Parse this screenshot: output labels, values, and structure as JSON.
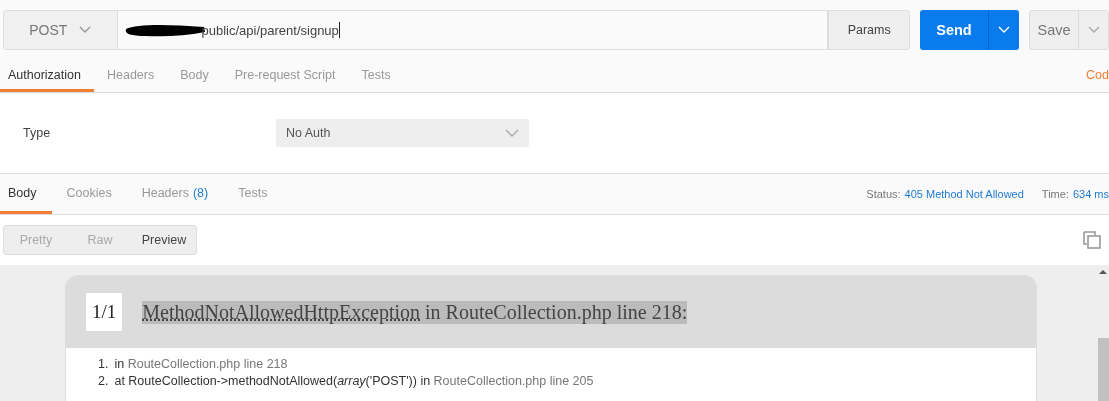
{
  "request": {
    "method": "POST",
    "url": "public/api/parent/signup",
    "url_redacted": true,
    "params_label": "Params",
    "send_label": "Send",
    "save_label": "Save"
  },
  "request_tabs": [
    {
      "label": "Authorization",
      "selected": true
    },
    {
      "label": "Headers",
      "selected": false
    },
    {
      "label": "Body",
      "selected": false
    },
    {
      "label": "Pre-request Script",
      "selected": false
    },
    {
      "label": "Tests",
      "selected": false
    }
  ],
  "code_link": "Cod",
  "auth": {
    "label": "Type",
    "value": "No Auth"
  },
  "response_tabs": [
    {
      "label": "Body",
      "selected": true
    },
    {
      "label": "Cookies",
      "selected": false
    },
    {
      "label": "Headers",
      "count": "(8)",
      "selected": false
    },
    {
      "label": "Tests",
      "selected": false
    }
  ],
  "status": {
    "label": "Status:",
    "value": "405 Method Not Allowed"
  },
  "time": {
    "label": "Time:",
    "value": "634 ms"
  },
  "view_modes": [
    {
      "label": "Pretty",
      "selected": false
    },
    {
      "label": "Raw",
      "selected": false
    },
    {
      "label": "Preview",
      "selected": true
    }
  ],
  "preview": {
    "counter": "1/1",
    "exception": "MethodNotAllowedHttpException",
    "message": "in RouteCollection.php line 218:",
    "trace": [
      {
        "number": "1.",
        "text": "in",
        "file": "RouteCollection.php line 218"
      },
      {
        "number": "2.",
        "text": "at RouteCollection->methodNotAllowed(*array*('POST')) in",
        "file": "RouteCollection.php line 205"
      }
    ]
  }
}
